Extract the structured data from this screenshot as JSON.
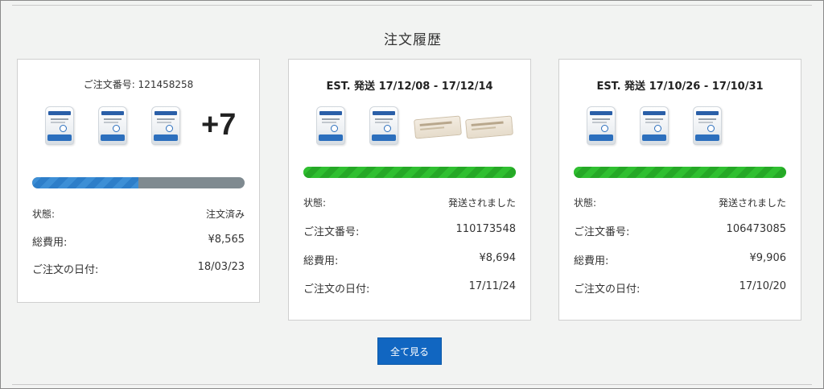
{
  "section_title": "注文履歴",
  "view_all_label": "全て見る",
  "orders": [
    {
      "header": "ご注文番号: 121458258",
      "more_count": "+7",
      "progress": 0.5,
      "status_key": "状態:",
      "status_value": "注文済み",
      "total_key": "総費用:",
      "total_value": "¥8,565",
      "date_key": "ご注文の日付:",
      "date_value": "18/03/23"
    },
    {
      "header": "EST. 発送 17/12/08 - 17/12/14",
      "progress": 1.0,
      "status_key": "状態:",
      "status_value": "発送されました",
      "order_no_key": "ご注文番号:",
      "order_no_value": "110173548",
      "total_key": "総費用:",
      "total_value": "¥8,694",
      "date_key": "ご注文の日付:",
      "date_value": "17/11/24"
    },
    {
      "header": "EST. 発送 17/10/26 - 17/10/31",
      "progress": 1.0,
      "status_key": "状態:",
      "status_value": "発送されました",
      "order_no_key": "ご注文番号:",
      "order_no_value": "106473085",
      "total_key": "総費用:",
      "total_value": "¥9,906",
      "date_key": "ご注文の日付:",
      "date_value": "17/10/20"
    }
  ],
  "colors": {
    "progress_in_progress": "#2d7ec9",
    "progress_done": "#29b32a",
    "button": "#1166c1"
  }
}
